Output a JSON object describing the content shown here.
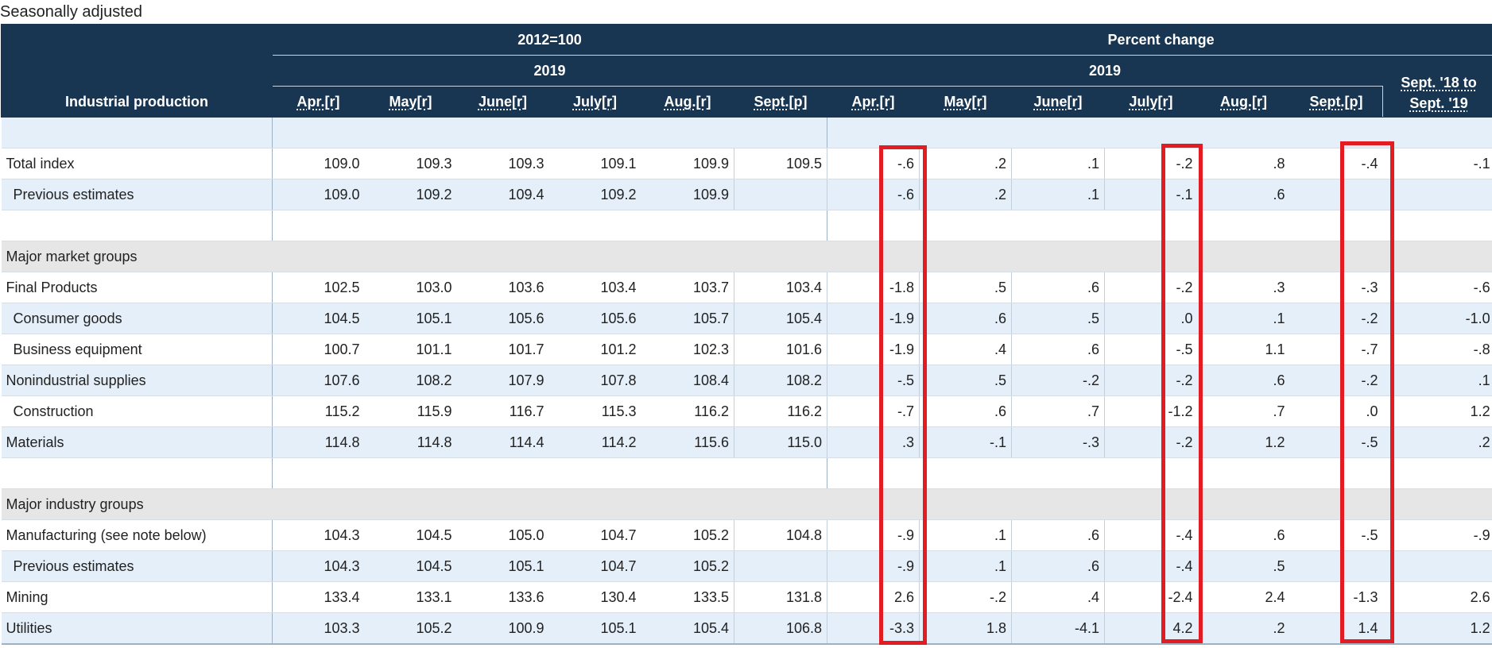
{
  "caption": "Seasonally adjusted",
  "header": {
    "label_column": "Industrial production",
    "group_index": "2012=100",
    "group_pct": "Percent change",
    "year_index": "2019",
    "year_pct": "2019",
    "yoy_line1": "Sept. '18 to",
    "yoy_line2": "Sept. '19",
    "index_months": [
      "Apr.[r]",
      "May[r]",
      "June[r]",
      "July[r]",
      "Aug.[r]",
      "Sept.[p]"
    ],
    "pct_months": [
      "Apr.[r]",
      "May[r]",
      "June[r]",
      "July[r]",
      "Aug.[r]",
      "Sept.[p]"
    ]
  },
  "rows": [
    {
      "type": "spacer",
      "style": "blue",
      "label": ""
    },
    {
      "type": "data",
      "style": "white",
      "indent": false,
      "label": "Total index",
      "index": [
        "109.0",
        "109.3",
        "109.3",
        "109.1",
        "109.9",
        "109.5"
      ],
      "pct": [
        "-.6",
        ".2",
        ".1",
        "-.2",
        ".8",
        "-.4",
        "-.1"
      ]
    },
    {
      "type": "data",
      "style": "blue",
      "indent": true,
      "label": "Previous estimates",
      "index": [
        "109.0",
        "109.2",
        "109.4",
        "109.2",
        "109.9",
        ""
      ],
      "pct": [
        "-.6",
        ".2",
        ".1",
        "-.1",
        ".6",
        "",
        ""
      ]
    },
    {
      "type": "spacer",
      "style": "white",
      "label": ""
    },
    {
      "type": "section",
      "style": "gray",
      "label": "Major market groups"
    },
    {
      "type": "data",
      "style": "white",
      "indent": false,
      "label": "Final Products",
      "index": [
        "102.5",
        "103.0",
        "103.6",
        "103.4",
        "103.7",
        "103.4"
      ],
      "pct": [
        "-1.8",
        ".5",
        ".6",
        "-.2",
        ".3",
        "-.3",
        "-.6"
      ]
    },
    {
      "type": "data",
      "style": "blue",
      "indent": true,
      "label": "Consumer goods",
      "index": [
        "104.5",
        "105.1",
        "105.6",
        "105.6",
        "105.7",
        "105.4"
      ],
      "pct": [
        "-1.9",
        ".6",
        ".5",
        ".0",
        ".1",
        "-.2",
        "-1.0"
      ]
    },
    {
      "type": "data",
      "style": "white",
      "indent": true,
      "label": "Business equipment",
      "index": [
        "100.7",
        "101.1",
        "101.7",
        "101.2",
        "102.3",
        "101.6"
      ],
      "pct": [
        "-1.9",
        ".4",
        ".6",
        "-.5",
        "1.1",
        "-.7",
        "-.8"
      ]
    },
    {
      "type": "data",
      "style": "blue",
      "indent": false,
      "label": "Nonindustrial supplies",
      "index": [
        "107.6",
        "108.2",
        "107.9",
        "107.8",
        "108.4",
        "108.2"
      ],
      "pct": [
        "-.5",
        ".5",
        "-.2",
        "-.2",
        ".6",
        "-.2",
        ".1"
      ]
    },
    {
      "type": "data",
      "style": "white",
      "indent": true,
      "label": "Construction",
      "index": [
        "115.2",
        "115.9",
        "116.7",
        "115.3",
        "116.2",
        "116.2"
      ],
      "pct": [
        "-.7",
        ".6",
        ".7",
        "-1.2",
        ".7",
        ".0",
        "1.2"
      ]
    },
    {
      "type": "data",
      "style": "blue",
      "indent": false,
      "label": "Materials",
      "index": [
        "114.8",
        "114.8",
        "114.4",
        "114.2",
        "115.6",
        "115.0"
      ],
      "pct": [
        ".3",
        "-.1",
        "-.3",
        "-.2",
        "1.2",
        "-.5",
        ".2"
      ]
    },
    {
      "type": "spacer",
      "style": "white",
      "label": ""
    },
    {
      "type": "section",
      "style": "gray",
      "label": "Major industry groups"
    },
    {
      "type": "data",
      "style": "white",
      "indent": false,
      "label": "Manufacturing (see note below)",
      "index": [
        "104.3",
        "104.5",
        "105.0",
        "104.7",
        "105.2",
        "104.8"
      ],
      "pct": [
        "-.9",
        ".1",
        ".6",
        "-.4",
        ".6",
        "-.5",
        "-.9"
      ]
    },
    {
      "type": "data",
      "style": "blue",
      "indent": true,
      "label": "Previous estimates",
      "index": [
        "104.3",
        "104.5",
        "105.1",
        "104.7",
        "105.2",
        ""
      ],
      "pct": [
        "-.9",
        ".1",
        ".6",
        "-.4",
        ".5",
        "",
        ""
      ]
    },
    {
      "type": "data",
      "style": "white",
      "indent": false,
      "label": "Mining",
      "index": [
        "133.4",
        "133.1",
        "133.6",
        "130.4",
        "133.5",
        "131.8"
      ],
      "pct": [
        "2.6",
        "-.2",
        ".4",
        "-2.4",
        "2.4",
        "-1.3",
        "2.6"
      ]
    },
    {
      "type": "data",
      "style": "blue",
      "indent": false,
      "label": "Utilities",
      "index": [
        "103.3",
        "105.2",
        "100.9",
        "105.1",
        "105.4",
        "106.8"
      ],
      "pct": [
        "-3.3",
        "1.8",
        "-4.1",
        "4.2",
        ".2",
        "1.4",
        "1.2"
      ]
    }
  ],
  "annotations": {
    "highlighted_columns": [
      "Percent change Apr.[r]",
      "Percent change July[r]",
      "Percent change Sept.[p]"
    ],
    "highlight_color": "#e31b23"
  },
  "colors": {
    "header_bg": "#183652",
    "row_blue": "#e4eff9",
    "row_gray": "#e6e6e6"
  }
}
